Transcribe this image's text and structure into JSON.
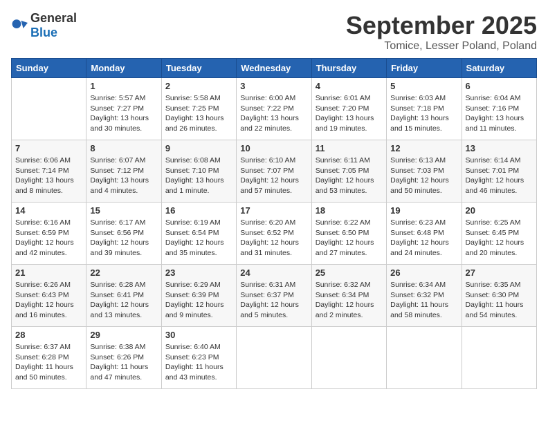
{
  "logo": {
    "general": "General",
    "blue": "Blue"
  },
  "title": "September 2025",
  "location": "Tomice, Lesser Poland, Poland",
  "days_of_week": [
    "Sunday",
    "Monday",
    "Tuesday",
    "Wednesday",
    "Thursday",
    "Friday",
    "Saturday"
  ],
  "weeks": [
    [
      {
        "day": "",
        "info": ""
      },
      {
        "day": "1",
        "info": "Sunrise: 5:57 AM\nSunset: 7:27 PM\nDaylight: 13 hours\nand 30 minutes."
      },
      {
        "day": "2",
        "info": "Sunrise: 5:58 AM\nSunset: 7:25 PM\nDaylight: 13 hours\nand 26 minutes."
      },
      {
        "day": "3",
        "info": "Sunrise: 6:00 AM\nSunset: 7:22 PM\nDaylight: 13 hours\nand 22 minutes."
      },
      {
        "day": "4",
        "info": "Sunrise: 6:01 AM\nSunset: 7:20 PM\nDaylight: 13 hours\nand 19 minutes."
      },
      {
        "day": "5",
        "info": "Sunrise: 6:03 AM\nSunset: 7:18 PM\nDaylight: 13 hours\nand 15 minutes."
      },
      {
        "day": "6",
        "info": "Sunrise: 6:04 AM\nSunset: 7:16 PM\nDaylight: 13 hours\nand 11 minutes."
      }
    ],
    [
      {
        "day": "7",
        "info": "Sunrise: 6:06 AM\nSunset: 7:14 PM\nDaylight: 13 hours\nand 8 minutes."
      },
      {
        "day": "8",
        "info": "Sunrise: 6:07 AM\nSunset: 7:12 PM\nDaylight: 13 hours\nand 4 minutes."
      },
      {
        "day": "9",
        "info": "Sunrise: 6:08 AM\nSunset: 7:10 PM\nDaylight: 13 hours\nand 1 minute."
      },
      {
        "day": "10",
        "info": "Sunrise: 6:10 AM\nSunset: 7:07 PM\nDaylight: 12 hours\nand 57 minutes."
      },
      {
        "day": "11",
        "info": "Sunrise: 6:11 AM\nSunset: 7:05 PM\nDaylight: 12 hours\nand 53 minutes."
      },
      {
        "day": "12",
        "info": "Sunrise: 6:13 AM\nSunset: 7:03 PM\nDaylight: 12 hours\nand 50 minutes."
      },
      {
        "day": "13",
        "info": "Sunrise: 6:14 AM\nSunset: 7:01 PM\nDaylight: 12 hours\nand 46 minutes."
      }
    ],
    [
      {
        "day": "14",
        "info": "Sunrise: 6:16 AM\nSunset: 6:59 PM\nDaylight: 12 hours\nand 42 minutes."
      },
      {
        "day": "15",
        "info": "Sunrise: 6:17 AM\nSunset: 6:56 PM\nDaylight: 12 hours\nand 39 minutes."
      },
      {
        "day": "16",
        "info": "Sunrise: 6:19 AM\nSunset: 6:54 PM\nDaylight: 12 hours\nand 35 minutes."
      },
      {
        "day": "17",
        "info": "Sunrise: 6:20 AM\nSunset: 6:52 PM\nDaylight: 12 hours\nand 31 minutes."
      },
      {
        "day": "18",
        "info": "Sunrise: 6:22 AM\nSunset: 6:50 PM\nDaylight: 12 hours\nand 27 minutes."
      },
      {
        "day": "19",
        "info": "Sunrise: 6:23 AM\nSunset: 6:48 PM\nDaylight: 12 hours\nand 24 minutes."
      },
      {
        "day": "20",
        "info": "Sunrise: 6:25 AM\nSunset: 6:45 PM\nDaylight: 12 hours\nand 20 minutes."
      }
    ],
    [
      {
        "day": "21",
        "info": "Sunrise: 6:26 AM\nSunset: 6:43 PM\nDaylight: 12 hours\nand 16 minutes."
      },
      {
        "day": "22",
        "info": "Sunrise: 6:28 AM\nSunset: 6:41 PM\nDaylight: 12 hours\nand 13 minutes."
      },
      {
        "day": "23",
        "info": "Sunrise: 6:29 AM\nSunset: 6:39 PM\nDaylight: 12 hours\nand 9 minutes."
      },
      {
        "day": "24",
        "info": "Sunrise: 6:31 AM\nSunset: 6:37 PM\nDaylight: 12 hours\nand 5 minutes."
      },
      {
        "day": "25",
        "info": "Sunrise: 6:32 AM\nSunset: 6:34 PM\nDaylight: 12 hours\nand 2 minutes."
      },
      {
        "day": "26",
        "info": "Sunrise: 6:34 AM\nSunset: 6:32 PM\nDaylight: 11 hours\nand 58 minutes."
      },
      {
        "day": "27",
        "info": "Sunrise: 6:35 AM\nSunset: 6:30 PM\nDaylight: 11 hours\nand 54 minutes."
      }
    ],
    [
      {
        "day": "28",
        "info": "Sunrise: 6:37 AM\nSunset: 6:28 PM\nDaylight: 11 hours\nand 50 minutes."
      },
      {
        "day": "29",
        "info": "Sunrise: 6:38 AM\nSunset: 6:26 PM\nDaylight: 11 hours\nand 47 minutes."
      },
      {
        "day": "30",
        "info": "Sunrise: 6:40 AM\nSunset: 6:23 PM\nDaylight: 11 hours\nand 43 minutes."
      },
      {
        "day": "",
        "info": ""
      },
      {
        "day": "",
        "info": ""
      },
      {
        "day": "",
        "info": ""
      },
      {
        "day": "",
        "info": ""
      }
    ]
  ]
}
